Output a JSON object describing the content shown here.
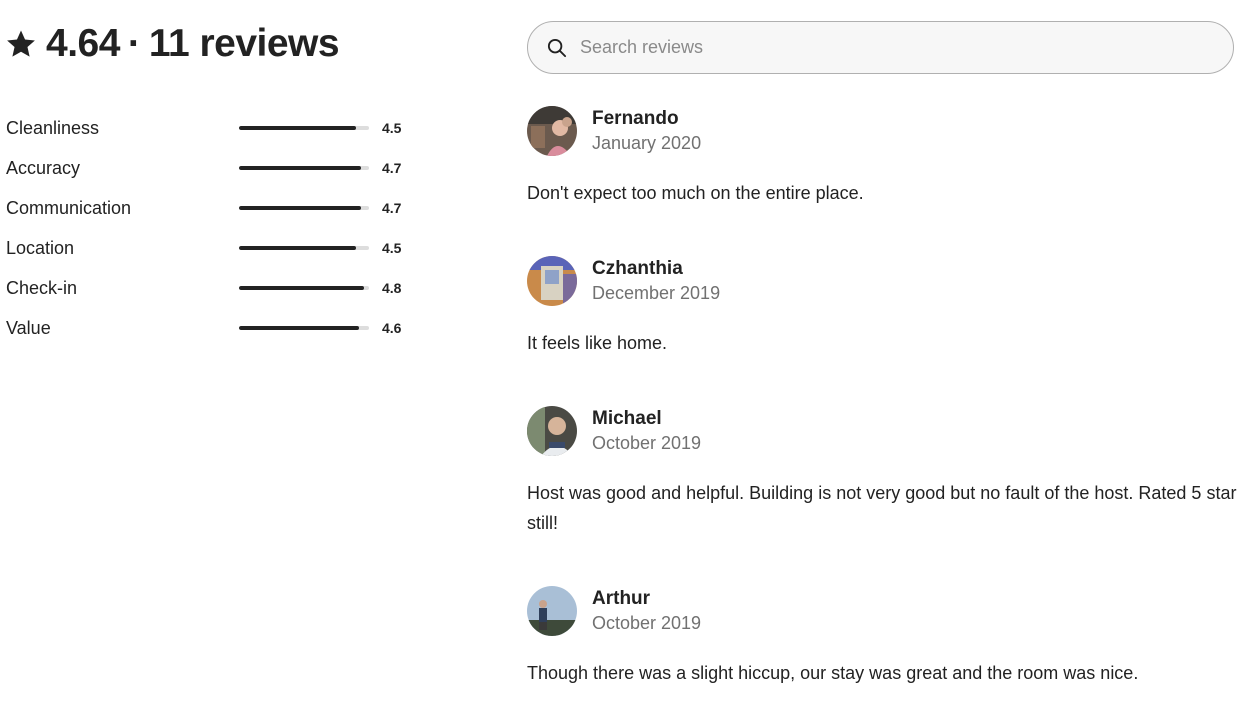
{
  "summary": {
    "rating": "4.64",
    "separator": "·",
    "reviews_count": "11 reviews"
  },
  "categories": [
    {
      "label": "Cleanliness",
      "value": "4.5",
      "fraction": 0.9
    },
    {
      "label": "Accuracy",
      "value": "4.7",
      "fraction": 0.94
    },
    {
      "label": "Communication",
      "value": "4.7",
      "fraction": 0.94
    },
    {
      "label": "Location",
      "value": "4.5",
      "fraction": 0.9
    },
    {
      "label": "Check-in",
      "value": "4.8",
      "fraction": 0.96
    },
    {
      "label": "Value",
      "value": "4.6",
      "fraction": 0.92
    }
  ],
  "search": {
    "placeholder": "Search reviews"
  },
  "reviews": [
    {
      "name": "Fernando",
      "date": "January 2020",
      "text": "Don't expect too much on the entire place."
    },
    {
      "name": "Czhanthia",
      "date": "December 2019",
      "text": "It feels like home."
    },
    {
      "name": "Michael",
      "date": "October 2019",
      "text": "Host was good and helpful. Building is not very good but no fault of the host. Rated 5 star still!"
    },
    {
      "name": "Arthur",
      "date": "October 2019",
      "text": "Though there was a slight hiccup, our stay was great and the room was nice."
    }
  ],
  "colors": {
    "text": "#222222",
    "muted": "#717171",
    "bar_track": "#dddddd",
    "bar_fill": "#222222"
  },
  "icons": {
    "star": "star-icon",
    "search": "search-icon"
  }
}
